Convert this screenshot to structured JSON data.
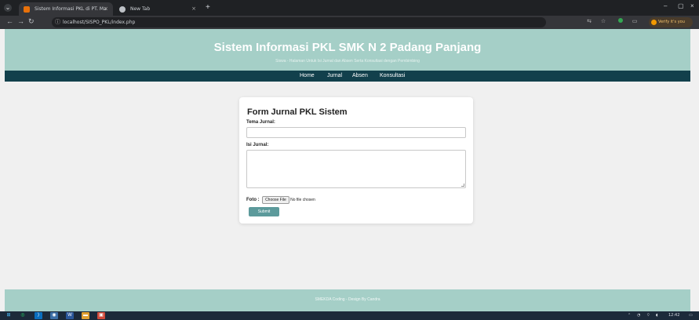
{
  "browser": {
    "tabs": [
      {
        "title": "Sistem Informasi PKL di PT. Ma",
        "active": true,
        "favicon_color": "#e8710a"
      },
      {
        "title": "New Tab",
        "active": false,
        "favicon_color": "#bdc1c6"
      }
    ],
    "new_tab_label": "+",
    "close_label": "×",
    "address": "localhost/SISPO_PKL/index.php",
    "profile_label": "Verify it's you",
    "window_controls": {
      "minimize": "–",
      "maximize": "▢",
      "close": "×"
    }
  },
  "site": {
    "title": "Sistem Informasi PKL SMK N 2 Padang Panjang",
    "subtitle": "Siswa - Halaman Untuk Isi Jurnal dan Absen Serta Konsultasi dengan Pembimbing",
    "nav": [
      "Home",
      "Jurnal",
      "Absen",
      "Konsultasi"
    ],
    "footer": "SMEKDA Coding - Design By Candra"
  },
  "form": {
    "title": "Form Jurnal PKL Sistem",
    "tema_label": "Tema Jurnal:",
    "tema_value": "",
    "isi_label": "Isi Jurnal:",
    "isi_value": "",
    "foto_label": "Foto :",
    "file_button": "Choose File",
    "file_status": "No file chosen",
    "submit": "Submit"
  },
  "taskbar": {
    "clock_time": "12:42",
    "icons": [
      "windows-start-icon",
      "whatsapp-icon",
      "vscode-icon",
      "chrome-icon",
      "word-icon",
      "file-explorer-icon",
      "app-icon"
    ]
  },
  "colors": {
    "header_bg": "#a5cfc7",
    "nav_bg": "#12404c",
    "submit_bg": "#5c9a9b",
    "page_bg": "#f0f0f0"
  }
}
